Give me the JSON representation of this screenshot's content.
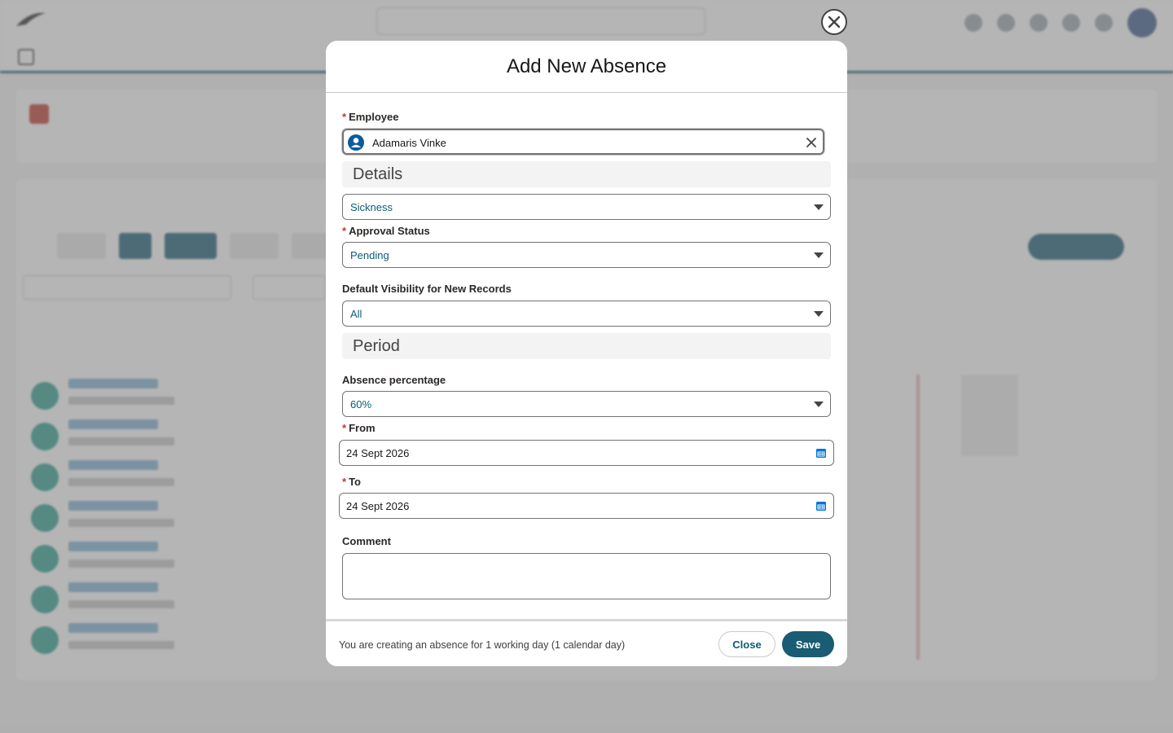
{
  "modal": {
    "title": "Add New Absence",
    "employee_label": "Employee",
    "employee_value": "Adamaris Vinke",
    "details_section": "Details",
    "absence_type_value": "Sickness",
    "approval_label": "Approval Status",
    "approval_value": "Pending",
    "visibility_label": "Default Visibility for New Records",
    "visibility_value": "All",
    "period_section": "Period",
    "percentage_label": "Absence percentage",
    "percentage_value": "60%",
    "from_label": "From",
    "from_value": "24 Sept 2026",
    "to_label": "To",
    "to_value": "24 Sept 2026",
    "comment_label": "Comment",
    "comment_value": "",
    "footer_info": "You are creating an absence for 1 working day (1 calendar day)",
    "close_label": "Close",
    "save_label": "Save",
    "required_mark": "*"
  },
  "colors": {
    "accent": "#1a5c73",
    "required": "#c23934",
    "calendar_icon": "#0176d3"
  },
  "icons": {
    "dismiss": "close-icon",
    "employee_avatar": "user-icon",
    "clear": "clear-icon",
    "dropdown": "chevron-down-icon",
    "date": "calendar-icon"
  }
}
